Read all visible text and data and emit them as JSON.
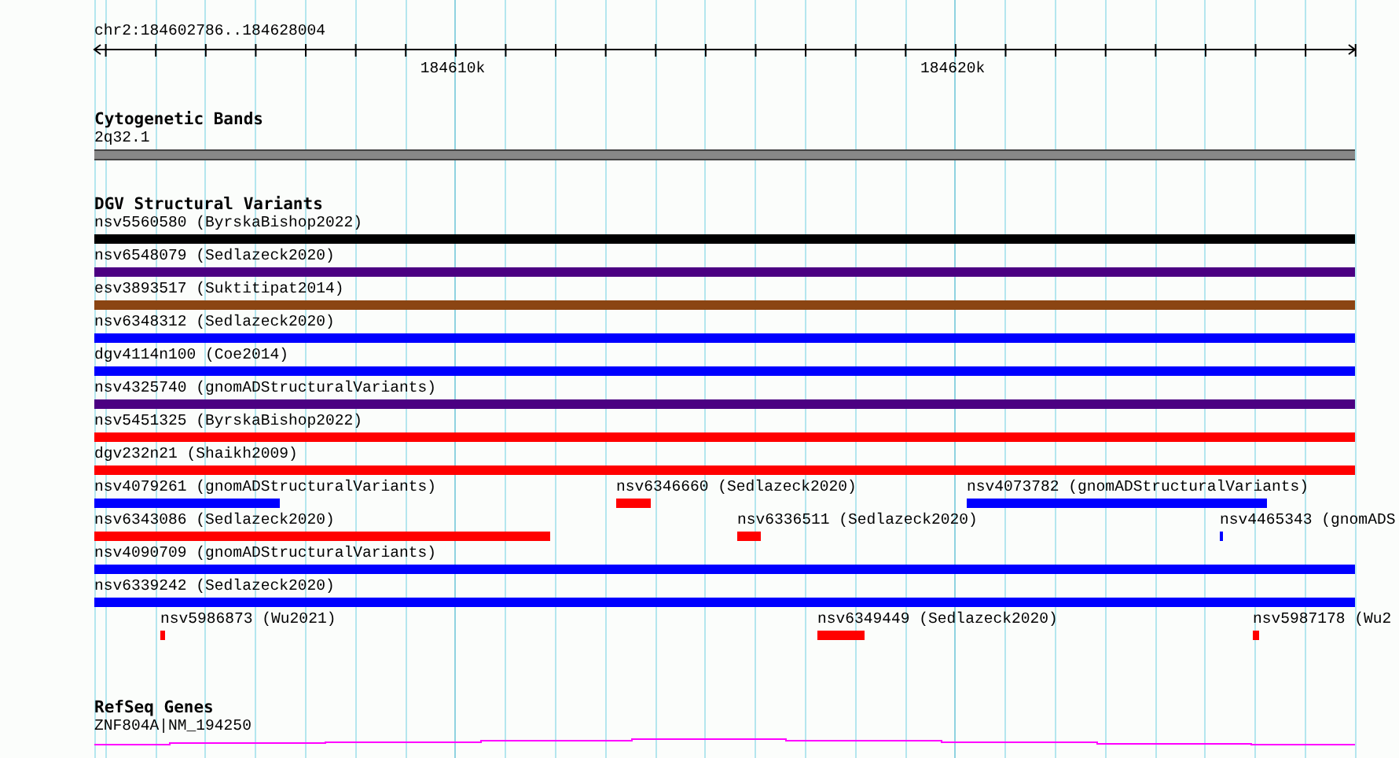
{
  "location": "chr2:184602786..184628004",
  "ruler": {
    "ticks": [
      "184610k",
      "184620k"
    ]
  },
  "tracks": [
    {
      "title": "Cytogenetic Bands",
      "kind": "bands",
      "rows": [
        {
          "features": [
            {
              "label": "2q32.1",
              "color": "#888888"
            }
          ]
        }
      ]
    },
    {
      "title": "DGV Structural Variants",
      "kind": "variants",
      "rows": [
        {
          "features": [
            {
              "label": "nsv5560580 (ByrskaBishop2022)",
              "color": "#000000"
            }
          ]
        },
        {
          "features": [
            {
              "label": "nsv6548079 (Sedlazeck2020)",
              "color": "#4b0082"
            }
          ]
        },
        {
          "features": [
            {
              "label": "esv3893517 (Suktitipat2014)",
              "color": "#8b4513"
            }
          ]
        },
        {
          "features": [
            {
              "label": "nsv6348312 (Sedlazeck2020)",
              "color": "#0000ff"
            }
          ]
        },
        {
          "features": [
            {
              "label": "dgv4114n100 (Coe2014)",
              "color": "#0000ff"
            }
          ]
        },
        {
          "features": [
            {
              "label": "nsv4325740 (gnomADStructuralVariants)",
              "color": "#4b0082"
            }
          ]
        },
        {
          "features": [
            {
              "label": "nsv5451325 (ByrskaBishop2022)",
              "color": "#ff0000"
            }
          ]
        },
        {
          "features": [
            {
              "label": "dgv232n21 (Shaikh2009)",
              "color": "#ff0000"
            }
          ]
        },
        {
          "features": [
            {
              "label": "nsv4079261 (gnomADStructuralVariants)",
              "color": "#0000ff"
            },
            {
              "label": "nsv6346660 (Sedlazeck2020)",
              "color": "#ff0000"
            },
            {
              "label": "nsv4073782 (gnomADStructuralVariants)",
              "color": "#0000ff"
            }
          ]
        },
        {
          "features": [
            {
              "label": "nsv6343086 (Sedlazeck2020)",
              "color": "#ff0000"
            },
            {
              "label": "nsv6336511 (Sedlazeck2020)",
              "color": "#ff0000"
            },
            {
              "label": "nsv4465343 (gnomADS",
              "color": "#0000ff"
            }
          ]
        },
        {
          "features": [
            {
              "label": "nsv4090709 (gnomADStructuralVariants)",
              "color": "#0000ff"
            }
          ]
        },
        {
          "features": [
            {
              "label": "nsv6339242 (Sedlazeck2020)",
              "color": "#0000ff"
            }
          ]
        },
        {
          "features": [
            {
              "label": "nsv5986873 (Wu2021)",
              "color": "#ff0000"
            },
            {
              "label": "nsv6349449 (Sedlazeck2020)",
              "color": "#ff0000"
            },
            {
              "label": "nsv5987178 (Wu2",
              "color": "#ff0000"
            }
          ]
        }
      ]
    },
    {
      "title": "RefSeq Genes",
      "kind": "genes",
      "rows": [
        {
          "features": [
            {
              "label": "ZNF804A|NM_194250",
              "color": "#ff00ff"
            }
          ]
        }
      ]
    }
  ]
}
